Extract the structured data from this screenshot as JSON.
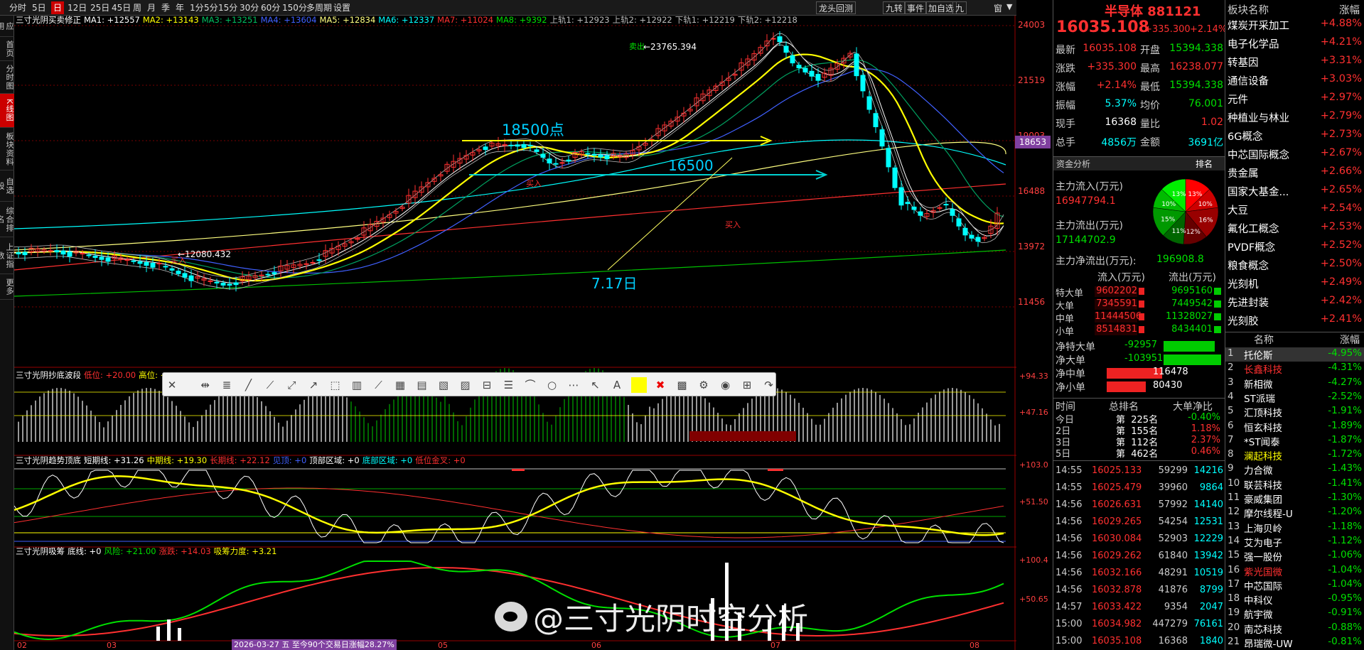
{
  "toolbar": {
    "items": [
      "分时",
      "5日",
      "日",
      "12日",
      "25日",
      "45日",
      "周",
      "月",
      "季",
      "年",
      "1分",
      "5分",
      "15分",
      "30分",
      "60分",
      "150分",
      "多周期",
      "设置"
    ],
    "active_index": 2,
    "right_items": [
      "龙头回测",
      "九转",
      "事件",
      "加自选",
      "九"
    ],
    "window_icons": [
      "窗"
    ]
  },
  "side_tabs": [
    "应用",
    "首页",
    "分时图",
    "K线图",
    "板块资料",
    "自选股",
    "综合排名",
    "上证指数",
    "更多"
  ],
  "side_active": 3,
  "ma_line": {
    "title": "三寸光阴买卖修正",
    "items": [
      {
        "t": "MA1: +12557",
        "c": "#ffffff"
      },
      {
        "t": "MA2: +13143",
        "c": "#ffff00"
      },
      {
        "t": "MA3: +13251",
        "c": "#00c060"
      },
      {
        "t": "MA4: +13604",
        "c": "#4060ff"
      },
      {
        "t": "MA5: +12834",
        "c": "#ffff80"
      },
      {
        "t": "MA6: +12337",
        "c": "#00ffff"
      },
      {
        "t": "MA7: +11024",
        "c": "#ff3030"
      },
      {
        "t": "MA8: +9392",
        "c": "#00e000"
      },
      {
        "t": "上轨1: +12923",
        "c": "#bbbbbb"
      },
      {
        "t": "上轨2: +12922",
        "c": "#bbbbbb"
      },
      {
        "t": "下轨1: +12219",
        "c": "#bbbbbb"
      },
      {
        "t": "下轨2: +12218",
        "c": "#bbbbbb"
      }
    ]
  },
  "price_axis": [
    "24003",
    "21519",
    "19003",
    "16488",
    "13972",
    "11456"
  ],
  "price_current_tag": "18653",
  "annotations": {
    "high": "23765.394",
    "low": "12080.432",
    "label_18500": "18500点",
    "label_16500": "16500",
    "label_date": "7.17日",
    "buy": "卖出",
    "sell_a": "买入"
  },
  "ind1": {
    "title": "三寸光阴抄底波段",
    "items": [
      {
        "t": "低位: +20.00",
        "c": "#ff3030"
      },
      {
        "t": "高位: +",
        "c": "#ffff00"
      }
    ],
    "axis": [
      "+94.33",
      "+47.16"
    ]
  },
  "ind2": {
    "title": "三寸光阴趋势顶底",
    "items": [
      {
        "t": "短期线: +31.26",
        "c": "#ffffff"
      },
      {
        "t": "中期线: +19.30",
        "c": "#ffff00"
      },
      {
        "t": "长期线: +22.12",
        "c": "#ff3030"
      },
      {
        "t": "见顶: +0",
        "c": "#4060ff"
      },
      {
        "t": "顶部区域: +0",
        "c": "#ffffff"
      },
      {
        "t": "底部区域: +0",
        "c": "#00ffff"
      },
      {
        "t": "低位金叉: +0",
        "c": "#ff3030"
      }
    ],
    "axis": [
      "+103.0",
      "+51.50"
    ]
  },
  "ind3": {
    "title": "三寸光阴吸筹",
    "items": [
      {
        "t": "底线: +0",
        "c": "#ffffff"
      },
      {
        "t": "风险: +21.00",
        "c": "#00e000"
      },
      {
        "t": "涨跌: +14.03",
        "c": "#ff3030"
      },
      {
        "t": "吸筹力度: +3.21",
        "c": "#ffff00"
      }
    ],
    "axis": [
      "+100.4",
      "+50.65"
    ]
  },
  "x_axis": [
    "02",
    "03",
    "05",
    "06",
    "07",
    "08"
  ],
  "x_note": "2026-03-27 五 至今90个交易日涨幅28.27%",
  "watermark": "@三寸光阴时空分析",
  "quote": {
    "name": "半导体 881121",
    "price": "16035.108",
    "change": "+335.300",
    "pct": "+2.14%",
    "rows": [
      {
        "l": "最新",
        "v": "16035.108",
        "vc": "#ff3030",
        "l2": "开盘",
        "v2": "15394.338",
        "v2c": "#00e000"
      },
      {
        "l": "涨跌",
        "v": "+335.300",
        "vc": "#ff3030",
        "l2": "最高",
        "v2": "16238.077",
        "v2c": "#ff3030"
      },
      {
        "l": "涨幅",
        "v": "+2.14%",
        "vc": "#ff3030",
        "l2": "最低",
        "v2": "15394.338",
        "v2c": "#00e000"
      },
      {
        "l": "振幅",
        "v": "5.37%",
        "vc": "#00ffff",
        "l2": "均价",
        "v2": "76.001",
        "v2c": "#00e000"
      },
      {
        "l": "现手",
        "v": "16368",
        "vc": "#ffffff",
        "l2": "量比",
        "v2": "1.02",
        "v2c": "#ff3030"
      },
      {
        "l": "总手",
        "v": "4856万",
        "vc": "#00ffff",
        "l2": "金额",
        "v2": "3691亿",
        "v2c": "#00ffff"
      }
    ],
    "funds_title": "资金分析",
    "funds_tag": "排名",
    "inflow_label": "主力流入(万元)",
    "inflow": "16947794.1",
    "outflow_label": "主力流出(万元)",
    "outflow": "17144702.9",
    "net_label": "主力净流出(万元):",
    "net": "196908.8",
    "pie": [
      {
        "p": "13%",
        "c": "#ff0000"
      },
      {
        "p": "10%",
        "c": "#cc0000"
      },
      {
        "p": "16%",
        "c": "#990000"
      },
      {
        "p": "12%",
        "c": "#660000"
      },
      {
        "p": "11%",
        "c": "#006600"
      },
      {
        "p": "15%",
        "c": "#009900"
      },
      {
        "p": "10%",
        "c": "#00bb00"
      },
      {
        "p": "13%",
        "c": "#00ee00"
      }
    ],
    "flow_head": [
      "流入(万元)",
      "流出(万元)"
    ],
    "flows": [
      {
        "l": "特大单",
        "in": "9602202",
        "out": "9695160"
      },
      {
        "l": "大单",
        "in": "7345591",
        "out": "7449542"
      },
      {
        "l": "中单",
        "in": "11444506",
        "out": "11328027"
      },
      {
        "l": "小单",
        "in": "8514831",
        "out": "8434401"
      }
    ],
    "nets": [
      {
        "l": "净特大单",
        "v": "-92957",
        "c": "#00cc00",
        "w": 120
      },
      {
        "l": "净大单",
        "v": "-103951",
        "c": "#00cc00",
        "w": 135
      },
      {
        "l": "净中单",
        "v": "116478",
        "c": "#ee2222",
        "w": 150
      },
      {
        "l": "净小单",
        "v": "80430",
        "c": "#ee2222",
        "w": 105
      }
    ],
    "rank_head": [
      "时间",
      "总排名",
      "大单净比"
    ],
    "ranks": [
      {
        "d": "今日",
        "r": "第  225名",
        "p": "-0.40%",
        "pc": "#00e000"
      },
      {
        "d": "2日",
        "r": "第  155名",
        "p": "1.18%",
        "pc": "#ff3030"
      },
      {
        "d": "3日",
        "r": "第  112名",
        "p": "2.37%",
        "pc": "#ff3030"
      },
      {
        "d": "5日",
        "r": "第  462名",
        "p": "0.46%",
        "pc": "#ff3030"
      }
    ],
    "ticks": [
      {
        "t": "14:55",
        "p": "16025.133",
        "v": "59299",
        "a": "14216"
      },
      {
        "t": "14:55",
        "p": "16025.479",
        "v": "39960",
        "a": "9864"
      },
      {
        "t": "14:56",
        "p": "16026.631",
        "v": "57992",
        "a": "14140"
      },
      {
        "t": "14:56",
        "p": "16029.265",
        "v": "54254",
        "a": "12531"
      },
      {
        "t": "14:56",
        "p": "16030.084",
        "v": "52903",
        "a": "12229"
      },
      {
        "t": "14:56",
        "p": "16029.262",
        "v": "61840",
        "a": "13942"
      },
      {
        "t": "14:56",
        "p": "16032.166",
        "v": "48291",
        "a": "10519"
      },
      {
        "t": "14:56",
        "p": "16032.878",
        "v": "41876",
        "a": "8799"
      },
      {
        "t": "14:57",
        "p": "16033.422",
        "v": "9354",
        "a": "2047"
      },
      {
        "t": "15:00",
        "p": "16034.982",
        "v": "447279",
        "a": "76161"
      },
      {
        "t": "15:00",
        "p": "16035.108",
        "v": "16368",
        "a": "1840"
      }
    ]
  },
  "sectors": {
    "head": [
      "板块名称",
      "涨幅"
    ],
    "rows": [
      {
        "n": "煤炭开采加工",
        "p": "+4.88%"
      },
      {
        "n": "电子化学品",
        "p": "+4.21%"
      },
      {
        "n": "转基因",
        "p": "+3.31%"
      },
      {
        "n": "通信设备",
        "p": "+3.03%"
      },
      {
        "n": "元件",
        "p": "+2.97%"
      },
      {
        "n": "种植业与林业",
        "p": "+2.79%"
      },
      {
        "n": "6G概念",
        "p": "+2.73%"
      },
      {
        "n": "中芯国际概念",
        "p": "+2.67%"
      },
      {
        "n": "贵金属",
        "p": "+2.66%"
      },
      {
        "n": "国家大基金...",
        "p": "+2.65%"
      },
      {
        "n": "大豆",
        "p": "+2.54%"
      },
      {
        "n": "氟化工概念",
        "p": "+2.53%"
      },
      {
        "n": "PVDF概念",
        "p": "+2.52%"
      },
      {
        "n": "粮食概念",
        "p": "+2.50%"
      },
      {
        "n": "光刻机",
        "p": "+2.49%"
      },
      {
        "n": "先进封装",
        "p": "+2.42%"
      },
      {
        "n": "光刻胶",
        "p": "+2.41%"
      }
    ],
    "rank_head": [
      "名称",
      "涨幅"
    ],
    "ranks": [
      {
        "i": "1",
        "n": "托伦斯",
        "p": "-4.95%",
        "nc": "#ffffff"
      },
      {
        "i": "2",
        "n": "长鑫科技",
        "p": "-4.31%",
        "nc": "#ff3030"
      },
      {
        "i": "3",
        "n": "新相微",
        "p": "-4.27%",
        "nc": "#ffffff"
      },
      {
        "i": "4",
        "n": "ST派瑞",
        "p": "-2.52%",
        "nc": "#ffffff"
      },
      {
        "i": "5",
        "n": "汇顶科技",
        "p": "-1.91%",
        "nc": "#ffffff"
      },
      {
        "i": "6",
        "n": "恒玄科技",
        "p": "-1.89%",
        "nc": "#ffffff"
      },
      {
        "i": "7",
        "n": "*ST闻泰",
        "p": "-1.87%",
        "nc": "#ffffff"
      },
      {
        "i": "8",
        "n": "澜起科技",
        "p": "-1.72%",
        "nc": "#ffff00"
      },
      {
        "i": "9",
        "n": "力合微",
        "p": "-1.43%",
        "nc": "#ffffff"
      },
      {
        "i": "10",
        "n": "联芸科技",
        "p": "-1.41%",
        "nc": "#ffffff"
      },
      {
        "i": "11",
        "n": "豪威集团",
        "p": "-1.30%",
        "nc": "#ffffff"
      },
      {
        "i": "12",
        "n": "摩尔线程-U",
        "p": "-1.20%",
        "nc": "#ffffff"
      },
      {
        "i": "13",
        "n": "上海贝岭",
        "p": "-1.18%",
        "nc": "#ffffff"
      },
      {
        "i": "14",
        "n": "艾为电子",
        "p": "-1.12%",
        "nc": "#ffffff"
      },
      {
        "i": "15",
        "n": "强一股份",
        "p": "-1.06%",
        "nc": "#ffffff"
      },
      {
        "i": "16",
        "n": "紫光国微",
        "p": "-1.04%",
        "nc": "#ff3030"
      },
      {
        "i": "17",
        "n": "中芯国际",
        "p": "-1.04%",
        "nc": "#ffffff"
      },
      {
        "i": "18",
        "n": "中科仪",
        "p": "-0.95%",
        "nc": "#ffffff"
      },
      {
        "i": "19",
        "n": "航宇微",
        "p": "-0.91%",
        "nc": "#ffffff"
      },
      {
        "i": "20",
        "n": "南芯科技",
        "p": "-0.88%",
        "nc": "#ffffff"
      },
      {
        "i": "21",
        "n": "昂瑞微-UW",
        "p": "-0.81%",
        "nc": "#ffffff"
      }
    ]
  }
}
